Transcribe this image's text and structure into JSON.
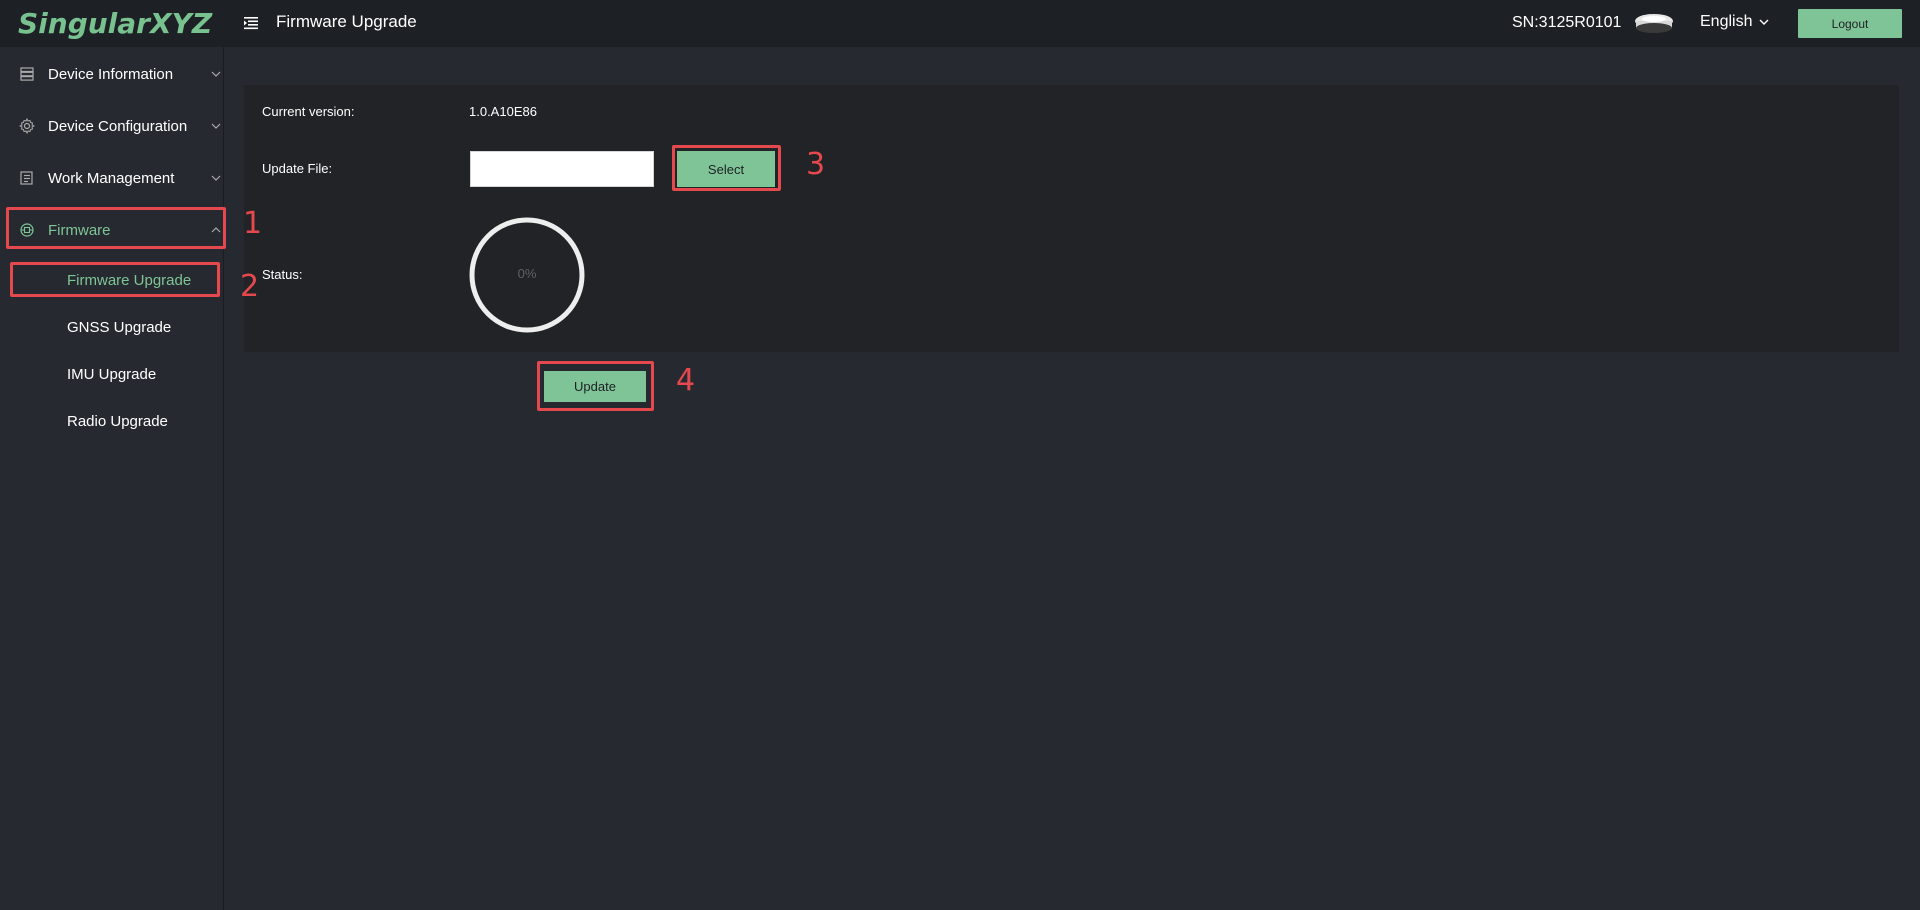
{
  "header": {
    "logo": "SingularXYZ",
    "title": "Firmware Upgrade",
    "serial": "SN:3125R0101",
    "language": "English",
    "logout_label": "Logout"
  },
  "sidebar": {
    "items": [
      {
        "label": "Device Information",
        "icon": "server-icon"
      },
      {
        "label": "Device Configuration",
        "icon": "gear-icon"
      },
      {
        "label": "Work Management",
        "icon": "list-icon"
      },
      {
        "label": "Firmware",
        "icon": "chip-icon"
      }
    ],
    "sub_items": [
      {
        "label": "Firmware Upgrade"
      },
      {
        "label": "GNSS Upgrade"
      },
      {
        "label": "IMU Upgrade"
      },
      {
        "label": "Radio Upgrade"
      }
    ]
  },
  "main": {
    "current_version_label": "Current version:",
    "current_version_value": "1.0.A10E86",
    "update_file_label": "Update File:",
    "update_file_value": "",
    "select_label": "Select",
    "status_label": "Status:",
    "progress_percent": 0,
    "progress_text": "0%",
    "update_label": "Update"
  },
  "annotations": [
    "1",
    "2",
    "3",
    "4"
  ],
  "colors": {
    "accent": "#7fc496",
    "annotation": "#e5484d",
    "background": "#262a30",
    "topbar": "#1d2025"
  }
}
